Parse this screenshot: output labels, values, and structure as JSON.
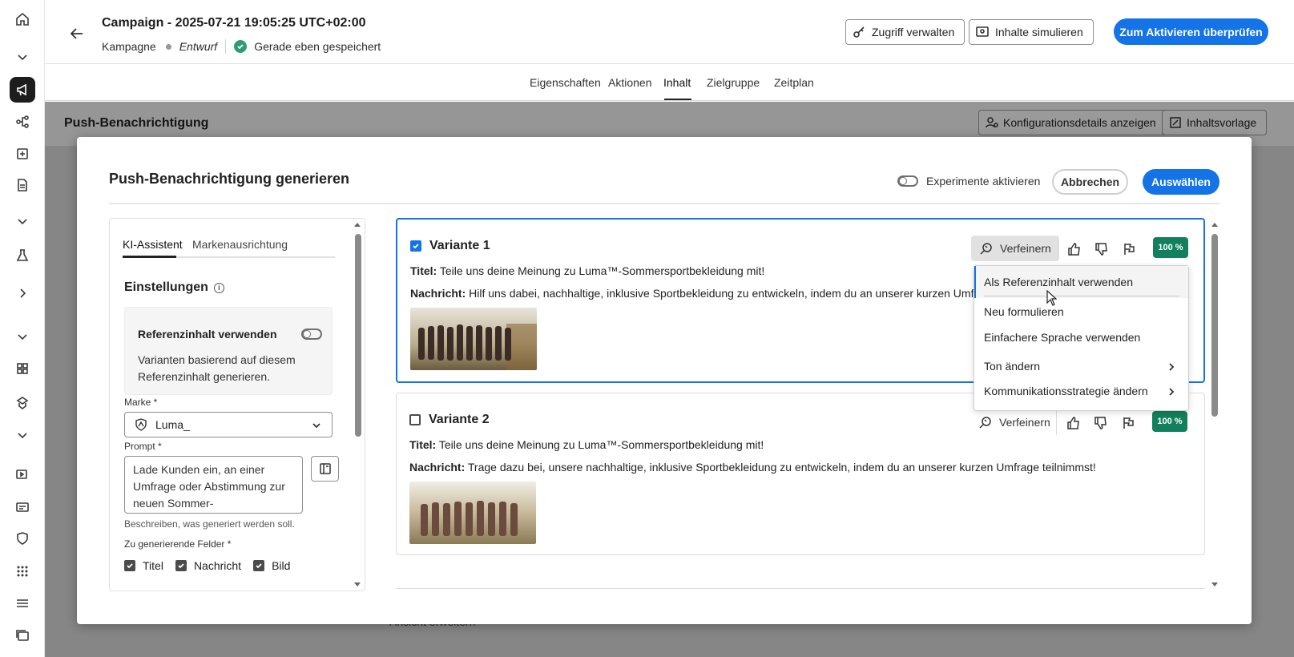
{
  "header": {
    "title": "Campaign - 2025-07-21 19:05:25 UTC+02:00",
    "type": "Kampagne",
    "status": "Entwurf",
    "saved": "Gerade eben gespeichert",
    "manage_access": "Zugriff verwalten",
    "simulate": "Inhalte simulieren",
    "review": "Zum Aktivieren überprüfen"
  },
  "tabs": [
    "Eigenschaften",
    "Aktionen",
    "Inhalt",
    "Zielgruppe",
    "Zeitplan"
  ],
  "background": {
    "title": "Push-Benachrichtigung",
    "config_btn": "Konfigurationsdetails anzeigen",
    "template_btn": "Inhaltsvorlage",
    "expand_view": "Ansicht erweitern"
  },
  "modal": {
    "title": "Push-Benachrichtigung generieren",
    "experiments": "Experimente aktivieren",
    "cancel": "Abbrechen",
    "select": "Auswählen"
  },
  "left_panel": {
    "tab_ai": "KI-Assistent",
    "tab_brand": "Markenausrichtung",
    "settings": "Einstellungen",
    "ref_title": "Referenzinhalt verwenden",
    "ref_desc": "Varianten basierend auf diesem Referenzinhalt generieren.",
    "brand_label": "Marke",
    "brand_value": "Luma_",
    "prompt_label": "Prompt",
    "prompt_value": "Lade Kunden ein, an einer Umfrage oder Abstimmung zur neuen Sommer-Sportbekleidungskolle...",
    "prompt_hint": "Beschreiben, was generiert werden soll.",
    "fields_label": "Zu generierende Felder",
    "field_title": "Titel",
    "field_message": "Nachricht",
    "field_image": "Bild"
  },
  "variants": [
    {
      "name": "Variante 1",
      "title_label": "Titel:",
      "title": "Teile uns deine Meinung zu Luma™-Sommersportbekleidung mit!",
      "message_label": "Nachricht:",
      "message": "Hilf uns dabei, nachhaltige, inklusive Sportbekleidung zu entwickeln, indem du an unserer kurzen Umfrage",
      "refine": "Verfeinern",
      "score": "100 %"
    },
    {
      "name": "Variante 2",
      "title_label": "Titel:",
      "title": "Teile uns deine Meinung zu Luma™-Sommersportbekleidung mit!",
      "message_label": "Nachricht:",
      "message": "Trage dazu bei, unsere nachhaltige, inklusive Sportbekleidung zu entwickeln, indem du an unserer kurzen Umfrage teilnimmst!",
      "refine": "Verfeinern",
      "score": "100 %"
    }
  ],
  "menu": {
    "items": [
      "Als Referenzinhalt verwenden",
      "Neu formulieren",
      "Einfachere Sprache verwenden",
      "Ton ändern",
      "Kommunikationsstrategie ändern"
    ]
  }
}
